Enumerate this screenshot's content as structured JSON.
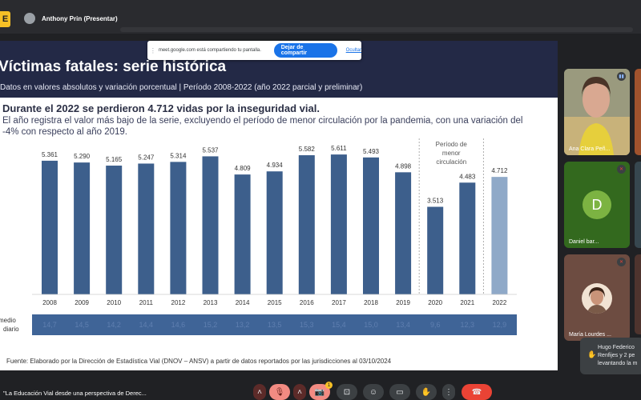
{
  "topbar": {
    "app_badge": "E",
    "presenter": "Anthony Prin (Presentar)"
  },
  "share_banner": {
    "message": "meet.google.com está compartiendo tu pantalla.",
    "stop_label": "Dejar de compartir",
    "hide_label": "Ocultar"
  },
  "slide": {
    "title": "Víctimas fatales: serie histórica",
    "subtitle": "Datos en valores absolutos y variación porcentual | Período 2008-2022 (año 2022 parcial y preliminar)",
    "headline": "Durante el 2022 se perdieron 4.712 vidas por la inseguridad vial.",
    "description": "El año registra el valor más bajo de la serie, excluyendo el período de menor circulación por la pandemia, con una variación del -4% con respecto al año 2019.",
    "footer": "Fuente: Elaborado por la Dirección de Estadística Vial (DNOV – ANSV) a partir de datos reportados por las jurisdicciones al 03/10/2024"
  },
  "chart_data": {
    "type": "bar",
    "categories": [
      "2008",
      "2009",
      "2010",
      "2011",
      "2012",
      "2013",
      "2014",
      "2015",
      "2016",
      "2017",
      "2018",
      "2019",
      "2020",
      "2021",
      "2022"
    ],
    "values": [
      5361,
      5290,
      5165,
      5247,
      5314,
      5537,
      4809,
      4934,
      5582,
      5611,
      5493,
      4898,
      3513,
      4483,
      4712
    ],
    "value_labels": [
      "5.361",
      "5.290",
      "5.165",
      "5.247",
      "5.314",
      "5.537",
      "4.809",
      "4.934",
      "5.582",
      "5.611",
      "5.493",
      "4.898",
      "3.513",
      "4.483",
      "4.712"
    ],
    "bar_color": "#3d5f8c",
    "highlight_color": "#8fa9c8",
    "highlight_category": "2022",
    "annotation": "Período de menor circulación",
    "annotated_categories": [
      "2020",
      "2021"
    ],
    "ylim": [
      0,
      6000
    ],
    "row_label": "medio diario",
    "row_values": [
      "14,7",
      "14,5",
      "14,2",
      "14,4",
      "14,6",
      "15,2",
      "13,2",
      "13,5",
      "15,3",
      "15,4",
      "15,0",
      "13,4",
      "9,6",
      "12,3",
      "12,9"
    ]
  },
  "participants": [
    {
      "name": "Ana Clara Peñ...",
      "muted": false
    },
    {
      "name": "Daniel bar...",
      "initial": "D",
      "muted": true
    },
    {
      "name": "María Lourdes ...",
      "muted": true
    }
  ],
  "toast": {
    "line1": "Hugo Federico",
    "line2": "Renfijes y 2 pe",
    "line3": "levantando la m"
  },
  "bottombar": {
    "meeting_title": "\"La Educación Vial desde una perspectiva de Derec..."
  },
  "controls": {
    "reactions_badge": "1"
  }
}
